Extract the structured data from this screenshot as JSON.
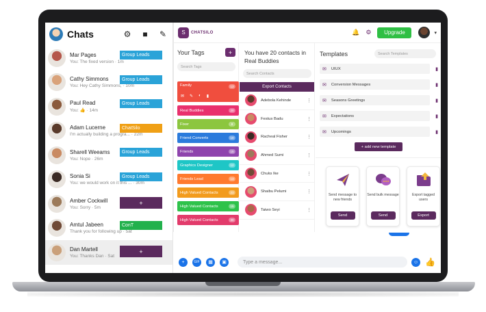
{
  "colors": {
    "brand": "#5b2a5e",
    "upgrade": "#2fbf44",
    "messenger_blue": "#1a73e8"
  },
  "messenger": {
    "title": "Chats",
    "icons": [
      "gear-icon",
      "video-icon",
      "compose-icon"
    ],
    "chats": [
      {
        "name": "Mar Pages",
        "preview": "You: The fixed version · 1m",
        "tag": "Group Leads",
        "tag_color": "#2aa3d8"
      },
      {
        "name": "Cathy Simmons",
        "preview": "You: Hey Cathy Simmons, · 10m",
        "tag": "Group Leads",
        "tag_color": "#2aa3d8"
      },
      {
        "name": "Paul Read",
        "preview": "You: 👍 · 14m",
        "tag": "Group Leads",
        "tag_color": "#2aa3d8"
      },
      {
        "name": "Adam Lucerne",
        "preview": "I'm actually building a progra... · 22m",
        "tag": "ChatSilo",
        "tag_color": "#f0a015"
      },
      {
        "name": "Sharell Weeams",
        "preview": "You: Nope · 26m",
        "tag": "Group Leads",
        "tag_color": "#2aa3d8"
      },
      {
        "name": "Sonia Si",
        "preview": "You: we would work on it this ... · 30m",
        "tag": "Group Leads",
        "tag_color": "#2aa3d8"
      },
      {
        "name": "Amber Cockwill",
        "preview": "You: Sorry · 5m",
        "tag": "",
        "tag_color": ""
      },
      {
        "name": "Amtul Jabeen",
        "preview": "Thank you for following up · 5at",
        "tag": "ConT",
        "tag_color": "#22b14c"
      },
      {
        "name": "Dan Martell",
        "preview": "You: Thanks Dan · Sat",
        "tag": "",
        "tag_color": ""
      }
    ],
    "add_tag_label": "+",
    "compose_placeholder": "Type a message...",
    "gif_label": "GIF"
  },
  "extension": {
    "logo_text": "CHATSILO",
    "upgrade_label": "Upgrade",
    "tags": {
      "title": "Your Tags",
      "add_label": "+",
      "search_placeholder": "Search Tags",
      "items": [
        {
          "label": "Family",
          "count": "13",
          "color": "#f04e3e",
          "expanded": true
        },
        {
          "label": "Real Buddies",
          "count": "20",
          "color": "#e9306d",
          "expanded": false
        },
        {
          "label": "Fixer",
          "count": "8",
          "color": "#8cc63f",
          "expanded": false
        },
        {
          "label": "Friend Converts",
          "count": "10",
          "color": "#2b7bdc",
          "expanded": false
        },
        {
          "label": "Friends",
          "count": "15",
          "color": "#8e44ad",
          "expanded": false
        },
        {
          "label": "Graphics Designer",
          "count": "12",
          "color": "#1ec6c6",
          "expanded": false
        },
        {
          "label": "Friends Lead",
          "count": "13",
          "color": "#ff7a2e",
          "expanded": false
        },
        {
          "label": "High Valued Contacts",
          "count": "23",
          "color": "#f29b1d",
          "expanded": false
        },
        {
          "label": "High Valued Contacts",
          "count": "15",
          "color": "#2ec24a",
          "expanded": false
        },
        {
          "label": "High Valued Contacts",
          "count": "30",
          "color": "#e23b6b",
          "expanded": false
        }
      ]
    },
    "contacts": {
      "title": "You have 20 contacts in Real Buddies",
      "search_placeholder": "Search Contacts",
      "export_label": "Export Contacts",
      "items": [
        {
          "name": "Adebola Kehinde"
        },
        {
          "name": "Festus Badu"
        },
        {
          "name": "Racheal Fisher"
        },
        {
          "name": "Ahmed Sumi"
        },
        {
          "name": "Chuks Ike"
        },
        {
          "name": "Shaibu Pelumi"
        },
        {
          "name": "Taiwo Seyi"
        }
      ]
    },
    "templates": {
      "title": "Templates",
      "search_placeholder": "Search Templates",
      "items": [
        {
          "name": "UIUX"
        },
        {
          "name": "Conversion Messages"
        },
        {
          "name": "Seasons Greetings"
        },
        {
          "name": "Expectations"
        },
        {
          "name": "Upcomings"
        }
      ],
      "add_label": "+ add new template",
      "cards": [
        {
          "text": "Send message to new friends",
          "button": "Send",
          "icon": "paper-plane-icon"
        },
        {
          "text": "Send bulk message",
          "button": "Send",
          "icon": "chat-bubbles-icon"
        },
        {
          "text": "Export tagged users",
          "button": "Export",
          "icon": "folder-export-icon"
        }
      ]
    }
  }
}
